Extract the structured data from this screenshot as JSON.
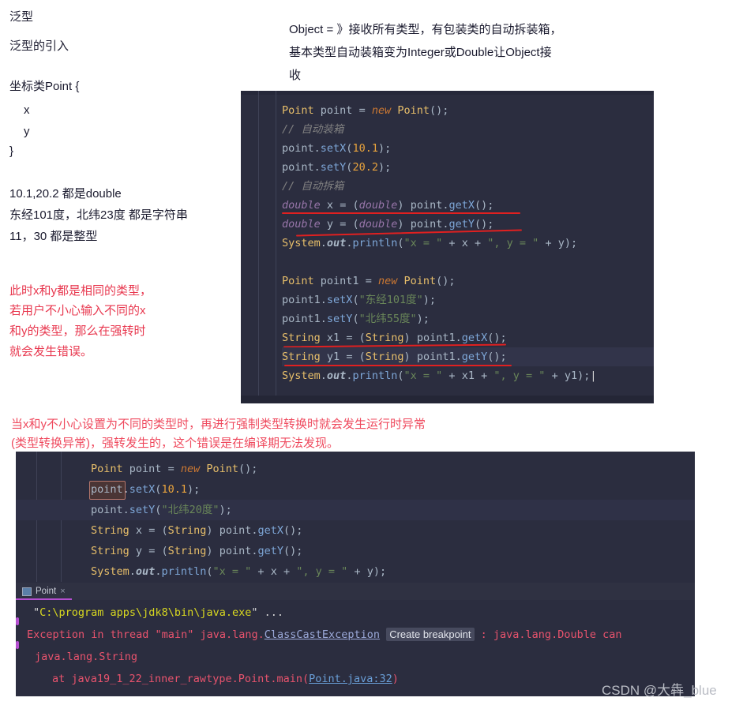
{
  "notes": {
    "title": "泛型",
    "subtitle": "泛型的引入",
    "class_decl": "坐标类Point {",
    "field_x": "x",
    "field_y": "y",
    "class_close": "}",
    "types_line1": "10.1,20.2 都是double",
    "types_line2": "东经101度，北纬23度 都是字符串",
    "types_line3": "11，30 都是整型",
    "object_note_line1": "Object = 》接收所有类型，有包装类的自动拆装箱，",
    "object_note_line2": "基本类型自动装箱变为Integer或Double让Object接",
    "object_note_line3": "收",
    "red_left_line1": "此时x和y都是相同的类型，",
    "red_left_line2": "若用户不小心输入不同的x",
    "red_left_line3": "和y的类型，那么在强转时",
    "red_left_line4": "就会发生错误。",
    "red_mid_line1": "当x和y不小心设置为不同的类型时，再进行强制类型转换时就会发生运行时异常",
    "red_mid_line2": "(类型转换异常)，强转发生的，这个错误是在编译期无法发现。"
  },
  "code_block_1": {
    "lines": [
      "Point point = new Point();",
      "// 自动装箱",
      "point.setX(10.1);",
      "point.setY(20.2);",
      "// 自动拆箱",
      "double x = (double) point.getX();",
      "double y = (double) point.getY();",
      "System.out.println(\"x = \" + x + \", y = \" + y);",
      "",
      "Point point1 = new Point();",
      "point1.setX(\"东经101度\");",
      "point1.setY(\"北纬55度\");",
      "String x1 = (String) point1.getX();",
      "String y1 = (String) point1.getY();",
      "System.out.println(\"x = \" + x1 + \", y = \" + y1);"
    ]
  },
  "code_block_2": {
    "lines": [
      "Point point = new Point();",
      "point.setX(10.1);",
      "point.setY(\"北纬20度\");",
      "String x = (String) point.getX();",
      "String y = (String) point.getY();",
      "System.out.println(\"x = \" + x + \", y = \" + y);"
    ],
    "error_token": "point"
  },
  "console": {
    "tab_label": "Point",
    "tab_close": "×",
    "line1_quote": "\"",
    "line1_path": "C:\\program apps\\jdk8\\bin\\java.exe",
    "line1_tail": "\" ...",
    "line2_a": "Exception in thread \"main\" java.lang.",
    "line2_link": "ClassCastException",
    "line2_badge": "Create breakpoint",
    "line2_b": " : java.lang.Double can",
    "line3": "java.lang.String",
    "line4_a": "at java19_1_22_inner_rawtype.Point.main(",
    "line4_link": "Point.java:32",
    "line4_b": ")"
  },
  "watermark": "CSDN @大犇_blue",
  "colors": {
    "editor_bg": "#2b2d3f",
    "red_text": "#e8384f",
    "underline_red": "#e02020",
    "tab_accent": "#b54fd0",
    "error_red": "#e8536d"
  }
}
